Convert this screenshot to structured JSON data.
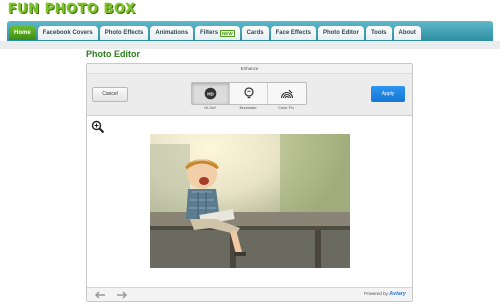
{
  "app": {
    "logo": "FUN PHOTO BOX"
  },
  "nav": {
    "tabs": [
      {
        "label": "Home",
        "active": true
      },
      {
        "label": "Facebook Covers"
      },
      {
        "label": "Photo Effects"
      },
      {
        "label": "Animations"
      },
      {
        "label": "Filters"
      },
      {
        "label": "Cards"
      },
      {
        "label": "Face Effects"
      },
      {
        "label": "Photo Editor"
      },
      {
        "label": "Tools"
      },
      {
        "label": "About"
      }
    ],
    "filters_badge": "NEW"
  },
  "page": {
    "title": "Photo Editor"
  },
  "editor": {
    "header": "Enhance",
    "cancel_label": "Cancel",
    "apply_label": "Apply",
    "tools": [
      {
        "label": "Hi-Def",
        "icon": "hd-icon",
        "selected": true
      },
      {
        "label": "Illuminate",
        "icon": "bulb-icon"
      },
      {
        "label": "Color Fix",
        "icon": "rainbow-icon"
      }
    ],
    "footer": {
      "powered_text": "Powered by",
      "powered_brand": "Aviary"
    }
  },
  "colors": {
    "accent_green": "#3d8c11",
    "nav_teal": "#2f8fa3",
    "apply_blue": "#1476d4"
  }
}
